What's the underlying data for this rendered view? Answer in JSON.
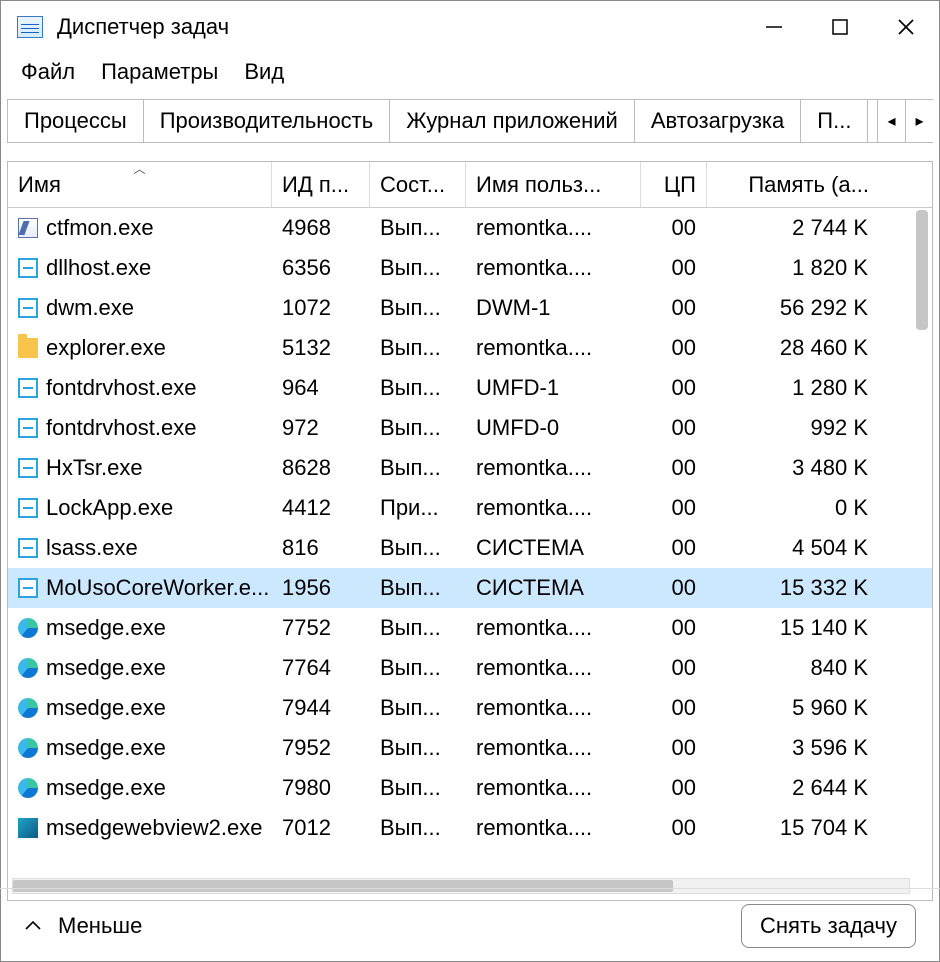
{
  "window": {
    "title": "Диспетчер задач"
  },
  "menu": {
    "file": "Файл",
    "options": "Параметры",
    "view": "Вид"
  },
  "tabs": {
    "processes": "Процессы",
    "performance": "Производительность",
    "app_history": "Журнал приложений",
    "startup": "Автозагрузка",
    "users_trunc": "П..."
  },
  "columns": {
    "name": "Имя",
    "pid": "ИД п...",
    "status": "Сост...",
    "user": "Имя польз...",
    "cpu": "ЦП",
    "memory": "Память (а..."
  },
  "rows": [
    {
      "icon": "notepad",
      "name": "ctfmon.exe",
      "pid": "4968",
      "status": "Вып...",
      "user": "remontka....",
      "cpu": "00",
      "mem": "2 744 K",
      "selected": false
    },
    {
      "icon": "generic",
      "name": "dllhost.exe",
      "pid": "6356",
      "status": "Вып...",
      "user": "remontka....",
      "cpu": "00",
      "mem": "1 820 K",
      "selected": false
    },
    {
      "icon": "generic",
      "name": "dwm.exe",
      "pid": "1072",
      "status": "Вып...",
      "user": "DWM-1",
      "cpu": "00",
      "mem": "56 292 K",
      "selected": false
    },
    {
      "icon": "folder",
      "name": "explorer.exe",
      "pid": "5132",
      "status": "Вып...",
      "user": "remontka....",
      "cpu": "00",
      "mem": "28 460 K",
      "selected": false
    },
    {
      "icon": "generic",
      "name": "fontdrvhost.exe",
      "pid": "964",
      "status": "Вып...",
      "user": "UMFD-1",
      "cpu": "00",
      "mem": "1 280 K",
      "selected": false
    },
    {
      "icon": "generic",
      "name": "fontdrvhost.exe",
      "pid": "972",
      "status": "Вып...",
      "user": "UMFD-0",
      "cpu": "00",
      "mem": "992 K",
      "selected": false
    },
    {
      "icon": "generic",
      "name": "HxTsr.exe",
      "pid": "8628",
      "status": "Вып...",
      "user": "remontka....",
      "cpu": "00",
      "mem": "3 480 K",
      "selected": false
    },
    {
      "icon": "generic",
      "name": "LockApp.exe",
      "pid": "4412",
      "status": "При...",
      "user": "remontka....",
      "cpu": "00",
      "mem": "0 K",
      "selected": false
    },
    {
      "icon": "generic",
      "name": "lsass.exe",
      "pid": "816",
      "status": "Вып...",
      "user": "СИСТЕМА",
      "cpu": "00",
      "mem": "4 504 K",
      "selected": false
    },
    {
      "icon": "generic",
      "name": "MoUsoCoreWorker.e...",
      "pid": "1956",
      "status": "Вып...",
      "user": "СИСТЕМА",
      "cpu": "00",
      "mem": "15 332 K",
      "selected": true
    },
    {
      "icon": "edge",
      "name": "msedge.exe",
      "pid": "7752",
      "status": "Вып...",
      "user": "remontka....",
      "cpu": "00",
      "mem": "15 140 K",
      "selected": false
    },
    {
      "icon": "edge",
      "name": "msedge.exe",
      "pid": "7764",
      "status": "Вып...",
      "user": "remontka....",
      "cpu": "00",
      "mem": "840 K",
      "selected": false
    },
    {
      "icon": "edge",
      "name": "msedge.exe",
      "pid": "7944",
      "status": "Вып...",
      "user": "remontka....",
      "cpu": "00",
      "mem": "5 960 K",
      "selected": false
    },
    {
      "icon": "edge",
      "name": "msedge.exe",
      "pid": "7952",
      "status": "Вып...",
      "user": "remontka....",
      "cpu": "00",
      "mem": "3 596 K",
      "selected": false
    },
    {
      "icon": "edge",
      "name": "msedge.exe",
      "pid": "7980",
      "status": "Вып...",
      "user": "remontka....",
      "cpu": "00",
      "mem": "2 644 K",
      "selected": false
    },
    {
      "icon": "webview",
      "name": "msedgewebview2.exe",
      "pid": "7012",
      "status": "Вып...",
      "user": "remontka....",
      "cpu": "00",
      "mem": "15 704 K",
      "selected": false
    }
  ],
  "footer": {
    "fewer": "Меньше",
    "end_task": "Снять задачу"
  }
}
